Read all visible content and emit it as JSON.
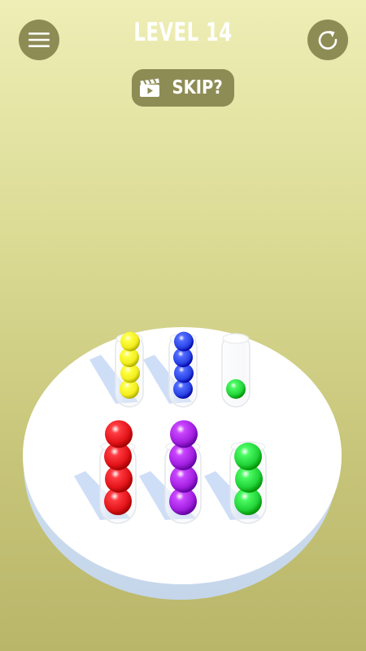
{
  "header": {
    "level_label": "LEVEL 14",
    "menu_icon": "hamburger-menu-icon",
    "restart_icon": "restart-icon"
  },
  "skip": {
    "label": "SKIP?",
    "icon": "clapperboard-video-icon"
  },
  "colors": {
    "ui_button": "#8e8c55",
    "yellow": "#f2ee1f",
    "blue": "#2a44e6",
    "green": "#22d33a",
    "red": "#e3141a",
    "purple": "#a21fe0"
  },
  "tubes": [
    {
      "name": "tube-back-left",
      "balls": [
        "yellow",
        "yellow",
        "yellow",
        "yellow"
      ]
    },
    {
      "name": "tube-back-center",
      "balls": [
        "blue",
        "blue",
        "blue",
        "blue"
      ]
    },
    {
      "name": "tube-back-right",
      "balls": [
        "green"
      ]
    },
    {
      "name": "tube-front-left",
      "balls": [
        "red",
        "red",
        "red",
        "red"
      ]
    },
    {
      "name": "tube-front-center",
      "balls": [
        "purple",
        "purple",
        "purple",
        "purple"
      ]
    },
    {
      "name": "tube-front-right",
      "balls": [
        "green",
        "green",
        "green"
      ]
    }
  ]
}
